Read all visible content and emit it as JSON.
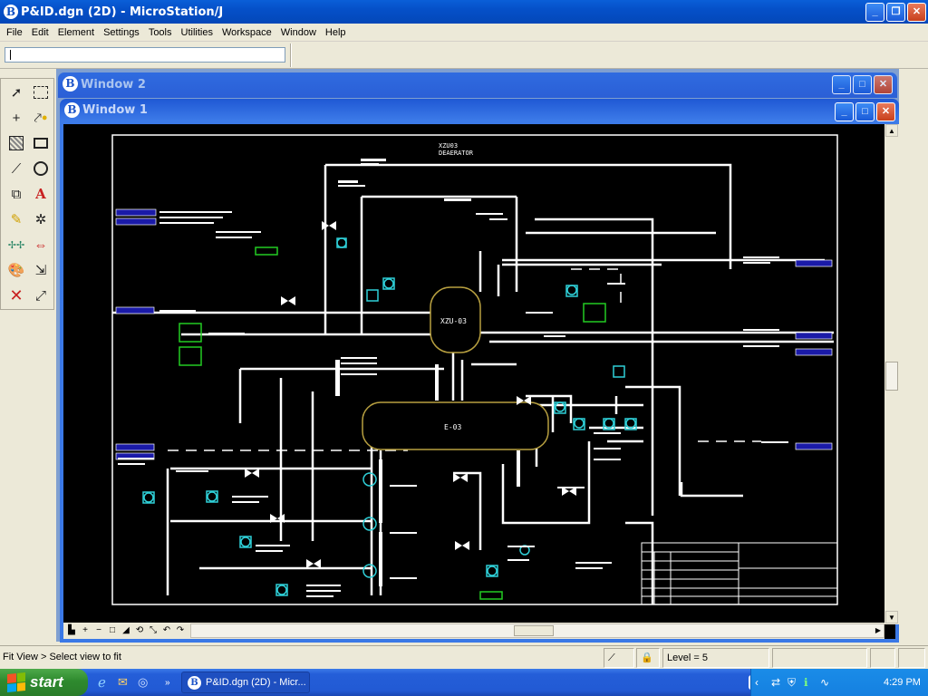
{
  "app": {
    "title": "P&ID.dgn (2D) - MicroStation/J",
    "logo_glyph": "B"
  },
  "menu": [
    "File",
    "Edit",
    "Element",
    "Settings",
    "Tools",
    "Utilities",
    "Workspace",
    "Window",
    "Help"
  ],
  "windows": {
    "window2_title": "Window 2",
    "window1_title": "Window 1"
  },
  "drawing": {
    "title_line1": "XZU03",
    "title_line2": "DEAERATOR",
    "vessel1_label": "XZU-03",
    "vessel2_label": "E-03"
  },
  "status": {
    "message": "Fit View > Select view to fit",
    "level": "Level = 5"
  },
  "taskbar": {
    "start_label": "start",
    "task_label": "P&ID.dgn (2D) - Micr...",
    "clock": "4:29 PM"
  },
  "colors": {
    "canvas": "#000000",
    "pipe": "#ffffff",
    "vessel_outline": "#b8a040",
    "instrument": "#2fd0d8",
    "tag_box": "#22cc22",
    "callout": "#1a1aa8"
  }
}
